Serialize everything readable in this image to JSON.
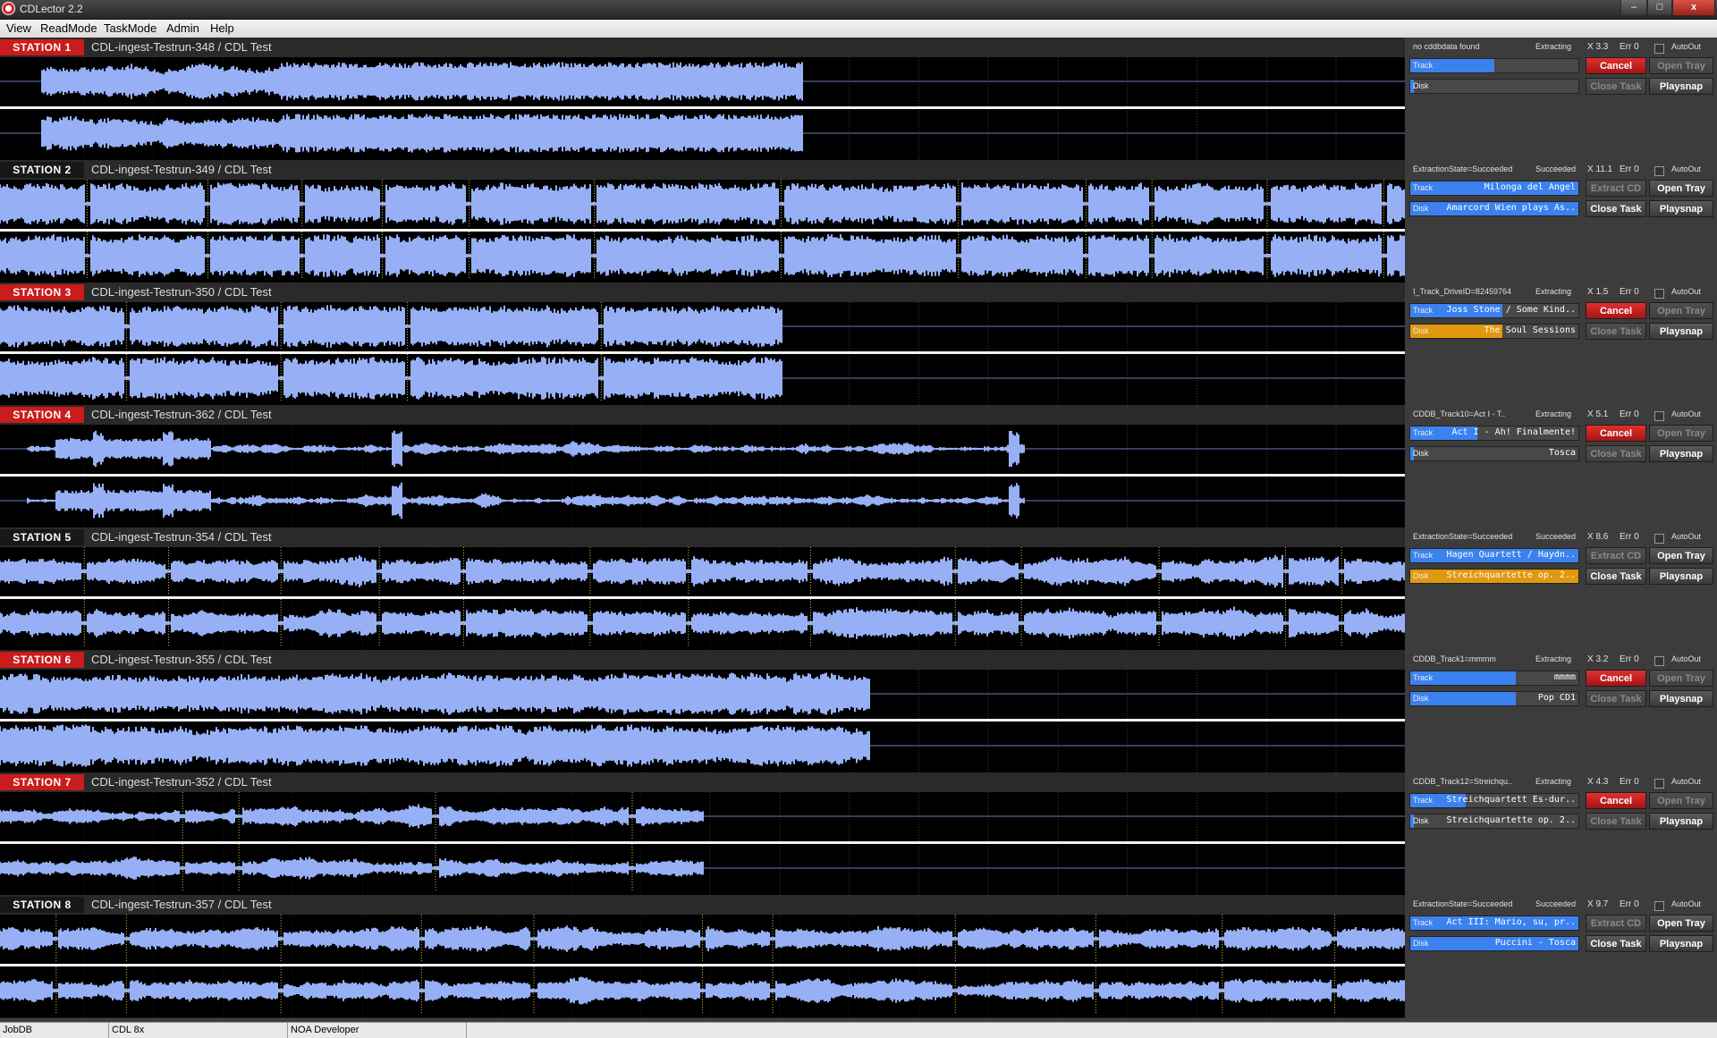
{
  "app": {
    "title": "CDLector 2.2"
  },
  "window_controls": {
    "min": "–",
    "max": "□",
    "close": "x"
  },
  "menu": [
    "View",
    "ReadMode",
    "TaskMode",
    "Admin",
    "Help"
  ],
  "colors": {
    "wave": "#97b0f5",
    "track_fill": "#3b82f0",
    "disk_fill_orange": "#e0980f",
    "badge_red": "#c91c1c"
  },
  "stations": [
    {
      "label": "STATION 1",
      "name": "CDL-ingest-Testrun-348 / CDL Test",
      "info": "no cddbdata found",
      "state": "Extracting",
      "speed": "X 3.3",
      "err": "Err 0",
      "autoout": "AutoOut",
      "track": {
        "label": "Track",
        "value": "",
        "progress": 0.5,
        "color": "blue"
      },
      "disk": {
        "label": "Disk",
        "value": "",
        "progress": 0.02,
        "color": "blue"
      },
      "buttons": {
        "primary": "Cancel",
        "tray": "Open Tray",
        "close": "Close Task",
        "playsnap": "Playsnap"
      },
      "mode": "extracting"
    },
    {
      "label": "STATION 2",
      "name": "CDL-ingest-Testrun-349 / CDL Test",
      "info": "ExtractionState=Succeeded",
      "state": "Succeeded",
      "speed": "X 11.1",
      "err": "Err 0",
      "autoout": "AutoOut",
      "track": {
        "label": "Track",
        "value": "Milonga del Angel",
        "progress": 1,
        "color": "blue"
      },
      "disk": {
        "label": "Disk",
        "value": "Amarcord Wien plays As..",
        "progress": 1,
        "color": "blue"
      },
      "buttons": {
        "primary": "Extract CD",
        "tray": "Open Tray",
        "close": "Close Task",
        "playsnap": "Playsnap"
      },
      "mode": "done"
    },
    {
      "label": "STATION 3",
      "name": "CDL-ingest-Testrun-350 / CDL Test",
      "info": "I_Track_DriveID=82459764",
      "state": "Extracting",
      "speed": "X 1.5",
      "err": "Err 0",
      "autoout": "AutoOut",
      "track": {
        "label": "Track",
        "value": "Joss Stone / Some Kind..",
        "progress": 0.55,
        "color": "blue"
      },
      "disk": {
        "label": "Disk",
        "value": "The Soul Sessions",
        "progress": 0.55,
        "color": "orange"
      },
      "buttons": {
        "primary": "Cancel",
        "tray": "Open Tray",
        "close": "Close Task",
        "playsnap": "Playsnap"
      },
      "mode": "extracting"
    },
    {
      "label": "STATION 4",
      "name": "CDL-ingest-Testrun-362 / CDL Test",
      "info": "CDDB_Track10=Act I - T..",
      "state": "Extracting",
      "speed": "X 5.1",
      "err": "Err 0",
      "autoout": "AutoOut",
      "track": {
        "label": "Track",
        "value": "Act I - Ah! Finalmente!",
        "progress": 0.4,
        "color": "blue"
      },
      "disk": {
        "label": "Disk",
        "value": "Tosca",
        "progress": 0.02,
        "color": "blue"
      },
      "buttons": {
        "primary": "Cancel",
        "tray": "Open Tray",
        "close": "Close Task",
        "playsnap": "Playsnap"
      },
      "mode": "extracting"
    },
    {
      "label": "STATION 5",
      "name": "CDL-ingest-Testrun-354 / CDL Test",
      "info": "ExtractionState=Succeeded",
      "state": "Succeeded",
      "speed": "X 8.6",
      "err": "Err 0",
      "autoout": "AutoOut",
      "track": {
        "label": "Track",
        "value": "Hagen Quartett / Haydn..",
        "progress": 1,
        "color": "blue"
      },
      "disk": {
        "label": "Disk",
        "value": "Streichquartette op. 2..",
        "progress": 1,
        "color": "orange"
      },
      "buttons": {
        "primary": "Extract CD",
        "tray": "Open Tray",
        "close": "Close Task",
        "playsnap": "Playsnap"
      },
      "mode": "done"
    },
    {
      "label": "STATION 6",
      "name": "CDL-ingest-Testrun-355 / CDL Test",
      "info": "CDDB_Track1=mmmm",
      "state": "Extracting",
      "speed": "X 3.2",
      "err": "Err 0",
      "autoout": "AutoOut",
      "track": {
        "label": "Track",
        "value": "mmmm",
        "progress": 0.63,
        "color": "blue"
      },
      "disk": {
        "label": "Disk",
        "value": "Pop CD1",
        "progress": 0.63,
        "color": "blue"
      },
      "buttons": {
        "primary": "Cancel",
        "tray": "Open Tray",
        "close": "Close Task",
        "playsnap": "Playsnap"
      },
      "mode": "extracting"
    },
    {
      "label": "STATION 7",
      "name": "CDL-ingest-Testrun-352 / CDL Test",
      "info": "CDDB_Track12=Streichqu..",
      "state": "Extracting",
      "speed": "X 4.3",
      "err": "Err 0",
      "autoout": "AutoOut",
      "track": {
        "label": "Track",
        "value": "Streichquartett Es-dur..",
        "progress": 0.33,
        "color": "blue"
      },
      "disk": {
        "label": "Disk",
        "value": "Streichquartette op. 2..",
        "progress": 0.02,
        "color": "blue"
      },
      "buttons": {
        "primary": "Cancel",
        "tray": "Open Tray",
        "close": "Close Task",
        "playsnap": "Playsnap"
      },
      "mode": "extracting"
    },
    {
      "label": "STATION 8",
      "name": "CDL-ingest-Testrun-357 / CDL Test",
      "info": "ExtractionState=Succeeded",
      "state": "Succeeded",
      "speed": "X 9.7",
      "err": "Err 0",
      "autoout": "AutoOut",
      "track": {
        "label": "Track",
        "value": "Act III: Mario, su, pr..",
        "progress": 1,
        "color": "blue"
      },
      "disk": {
        "label": "Disk",
        "value": "Puccini - Tosca",
        "progress": 1,
        "color": "blue"
      },
      "buttons": {
        "primary": "Extract CD",
        "tray": "Open Tray",
        "close": "Close Task",
        "playsnap": "Playsnap"
      },
      "mode": "done"
    }
  ],
  "statusbar": [
    "JobDB",
    "CDL 8x",
    "NOA Developer"
  ]
}
